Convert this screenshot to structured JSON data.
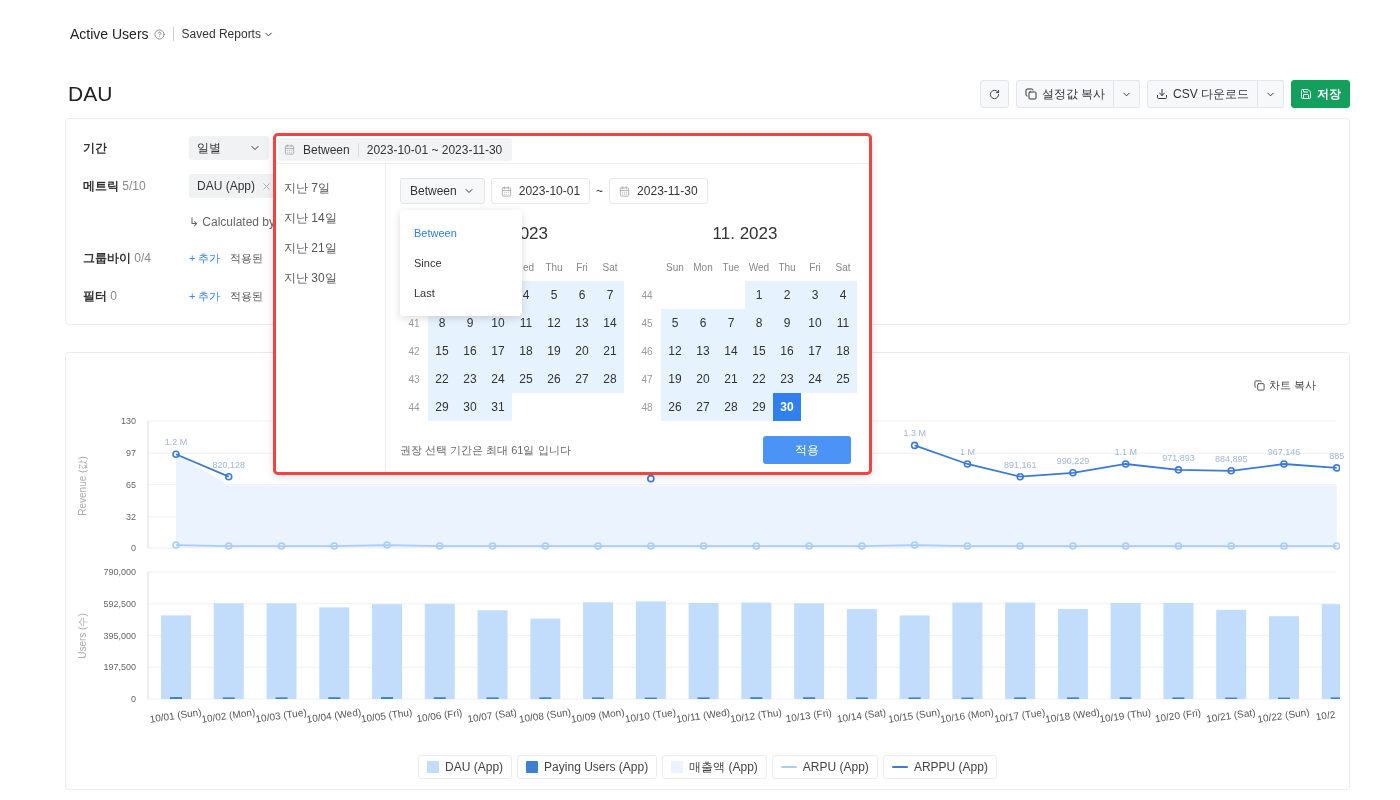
{
  "header": {
    "title": "Active Users",
    "saved_reports": "Saved Reports"
  },
  "page_title": "DAU",
  "toolbar": {
    "copy_settings": "설정값 복사",
    "csv_download": "CSV 다운로드",
    "save": "저장"
  },
  "settings": {
    "period": {
      "label": "기간",
      "granularity": "일별"
    },
    "metric": {
      "label": "메트릭",
      "count": "5/10",
      "chip": "DAU (App)",
      "note": "↳ Calculated by"
    },
    "group_by": {
      "label": "그룹바이",
      "count": "0/4",
      "add": "+ 추가",
      "applied": "적용된"
    },
    "filter": {
      "label": "필터",
      "count": "0",
      "add": "+ 추가",
      "applied": "적용된"
    }
  },
  "date_picker": {
    "mode": "Between",
    "range": "2023-10-01 ~ 2023-11-30",
    "presets": [
      "지난 7일",
      "지난 14일",
      "지난 21일",
      "지난 30일"
    ],
    "mode_select": "Between",
    "from": "2023-10-01",
    "separator": "~",
    "to": "2023-11-30",
    "menu": [
      {
        "label": "Between",
        "selected": true
      },
      {
        "label": "Since",
        "selected": false
      },
      {
        "label": "Last",
        "selected": false
      }
    ],
    "months": [
      {
        "title": "023",
        "kind": "covered",
        "weekdays": {
          "kind": "trailing",
          "labels": [
            "ed",
            "Thu",
            "Fri",
            "Sat"
          ]
        },
        "weeks": [
          {
            "kind": "trailing",
            "days": [
              {
                "day": "4",
                "selected": false
              },
              {
                "day": "5",
                "selected": false
              },
              {
                "day": "6",
                "selected": false
              },
              {
                "day": "7",
                "selected": false
              }
            ]
          },
          {
            "num": "41",
            "days": [
              {
                "day": "8",
                "selected": false
              },
              {
                "day": "9",
                "selected": false
              },
              {
                "day": "10",
                "selected": false
              },
              {
                "day": "11",
                "selected": false
              },
              {
                "day": "12",
                "selected": false
              },
              {
                "day": "13",
                "selected": false
              },
              {
                "day": "14",
                "selected": false
              }
            ]
          },
          {
            "num": "42",
            "days": [
              {
                "day": "15",
                "selected": false
              },
              {
                "day": "16",
                "selected": false
              },
              {
                "day": "17",
                "selected": false
              },
              {
                "day": "18",
                "selected": false
              },
              {
                "day": "19",
                "selected": false
              },
              {
                "day": "20",
                "selected": false
              },
              {
                "day": "21",
                "selected": false
              }
            ]
          },
          {
            "num": "43",
            "days": [
              {
                "day": "22",
                "selected": false
              },
              {
                "day": "23",
                "selected": false
              },
              {
                "day": "24",
                "selected": false
              },
              {
                "day": "25",
                "selected": false
              },
              {
                "day": "26",
                "selected": false
              },
              {
                "day": "27",
                "selected": false
              },
              {
                "day": "28",
                "selected": false
              }
            ]
          },
          {
            "num": "44",
            "kind": "leading",
            "days": [
              {
                "day": "29",
                "selected": false
              },
              {
                "day": "30",
                "selected": false
              },
              {
                "day": "31",
                "selected": false
              }
            ]
          }
        ]
      },
      {
        "title": "11. 2023",
        "kind": "full",
        "weekdays": {
          "kind": "full",
          "labels": [
            "Sun",
            "Mon",
            "Tue",
            "Wed",
            "Thu",
            "Fri",
            "Sat"
          ]
        },
        "weeks": [
          {
            "num": "44",
            "kind": "trailing",
            "days": [
              {
                "day": "1",
                "selected": false
              },
              {
                "day": "2",
                "selected": false
              },
              {
                "day": "3",
                "selected": false
              },
              {
                "day": "4",
                "selected": false
              }
            ]
          },
          {
            "num": "45",
            "days": [
              {
                "day": "5",
                "selected": false
              },
              {
                "day": "6",
                "selected": false
              },
              {
                "day": "7",
                "selected": false
              },
              {
                "day": "8",
                "selected": false
              },
              {
                "day": "9",
                "selected": false
              },
              {
                "day": "10",
                "selected": false
              },
              {
                "day": "11",
                "selected": false
              }
            ]
          },
          {
            "num": "46",
            "days": [
              {
                "day": "12",
                "selected": false
              },
              {
                "day": "13",
                "selected": false
              },
              {
                "day": "14",
                "selected": false
              },
              {
                "day": "15",
                "selected": false
              },
              {
                "day": "16",
                "selected": false
              },
              {
                "day": "17",
                "selected": false
              },
              {
                "day": "18",
                "selected": false
              }
            ]
          },
          {
            "num": "47",
            "days": [
              {
                "day": "19",
                "selected": false
              },
              {
                "day": "20",
                "selected": false
              },
              {
                "day": "21",
                "selected": false
              },
              {
                "day": "22",
                "selected": false
              },
              {
                "day": "23",
                "selected": false
              },
              {
                "day": "24",
                "selected": false
              },
              {
                "day": "25",
                "selected": false
              }
            ]
          },
          {
            "num": "48",
            "kind": "leading",
            "days": [
              {
                "day": "26",
                "selected": false
              },
              {
                "day": "27",
                "selected": false
              },
              {
                "day": "28",
                "selected": false
              },
              {
                "day": "29",
                "selected": false
              },
              {
                "day": "30",
                "selected": true
              }
            ]
          }
        ]
      }
    ],
    "note": "권장 선택 기간은 최대 61일 입니다",
    "apply": "적용"
  },
  "chart_card": {
    "copy_chart": "차트 복사",
    "revenue_chart": {
      "chart_data": {
        "type": "line",
        "ylabel": "Revenue (값)",
        "yticks": [
          0,
          32,
          65,
          97,
          130
        ],
        "ylim": [
          0,
          130
        ],
        "grid": true,
        "series": [
          {
            "name": "매출액 (App)",
            "type": "area",
            "color": "#eaf3fe",
            "values": [
              97,
              64,
              64,
              64,
              64,
              64,
              64,
              64,
              64,
              64,
              64,
              64,
              64,
              64,
              64,
              64,
              64,
              64,
              64,
              64,
              64,
              64,
              64
            ]
          },
          {
            "name": "ARPU (App)",
            "type": "line",
            "marker": "o",
            "color": "#a9cdf7",
            "values": [
              3,
              2,
              2,
              2,
              3,
              2,
              2,
              2,
              2,
              2,
              2,
              2,
              2,
              2,
              3,
              2,
              2,
              2,
              2,
              2,
              2,
              2,
              2
            ]
          },
          {
            "name": "ARPPU (App)",
            "type": "line",
            "marker": "o",
            "color": "#3b7bd4",
            "values": [
              96,
              73,
              null,
              null,
              null,
              null,
              null,
              null,
              null,
              71,
              null,
              null,
              null,
              null,
              105,
              86,
              73,
              77,
              86,
              80,
              79,
              86,
              82
            ]
          }
        ],
        "value_labels": [
          "1.2 M",
          "820,128",
          null,
          null,
          null,
          null,
          null,
          null,
          null,
          null,
          null,
          null,
          null,
          null,
          "1.3 M",
          "1 M",
          "891,161",
          "990,229",
          "1.1 M",
          "971,893",
          "884,895",
          "967,146",
          "885"
        ]
      }
    },
    "users_chart": {
      "chart_data": {
        "type": "bar",
        "ylabel": "Users (수)",
        "ylim": [
          0,
          790000
        ],
        "grid": true,
        "yticks": [
          {
            "value": 0,
            "label": "0"
          },
          {
            "value": 197500,
            "label": "197,500"
          },
          {
            "value": 395000,
            "label": "395,000"
          },
          {
            "value": 592500,
            "label": "592,500"
          },
          {
            "value": 790000,
            "label": "790,000"
          }
        ],
        "categories": [
          "10/01 (Sun)",
          "10/02 (Mon)",
          "10/03 (Tue)",
          "10/04 (Wed)",
          "10/05 (Thu)",
          "10/06 (Fri)",
          "10/07 (Sat)",
          "10/08 (Sun)",
          "10/09 (Mon)",
          "10/10 (Tue)",
          "10/11 (Wed)",
          "10/12 (Thu)",
          "10/13 (Fri)",
          "10/14 (Sat)",
          "10/15 (Sun)",
          "10/16 (Mon)",
          "10/17 (Tue)",
          "10/18 (Wed)",
          "10/19 (Thu)",
          "10/20 (Fri)",
          "10/21 (Sat)",
          "10/22 (Sun)",
          "10/2"
        ],
        "series": [
          {
            "name": "DAU (App)",
            "color": "#c2ddfc",
            "values": [
              520000,
              595000,
              595000,
              570000,
              590000,
              592000,
              552000,
              500000,
              602000,
              607000,
              598000,
              600000,
              595000,
              560000,
              520000,
              600000,
              600000,
              560000,
              598000,
              598000,
              555000,
              515000,
              590000
            ]
          },
          {
            "name": "Paying Users (App)",
            "color": "#3f7fd1",
            "values": [
              12000,
              10000,
              10000,
              11000,
              12000,
              11000,
              10000,
              10000,
              10000,
              9000,
              10000,
              11000,
              11000,
              10000,
              10000,
              9000,
              10000,
              10000,
              11000,
              10000,
              9000,
              9000,
              10000
            ]
          }
        ]
      }
    }
  }
}
